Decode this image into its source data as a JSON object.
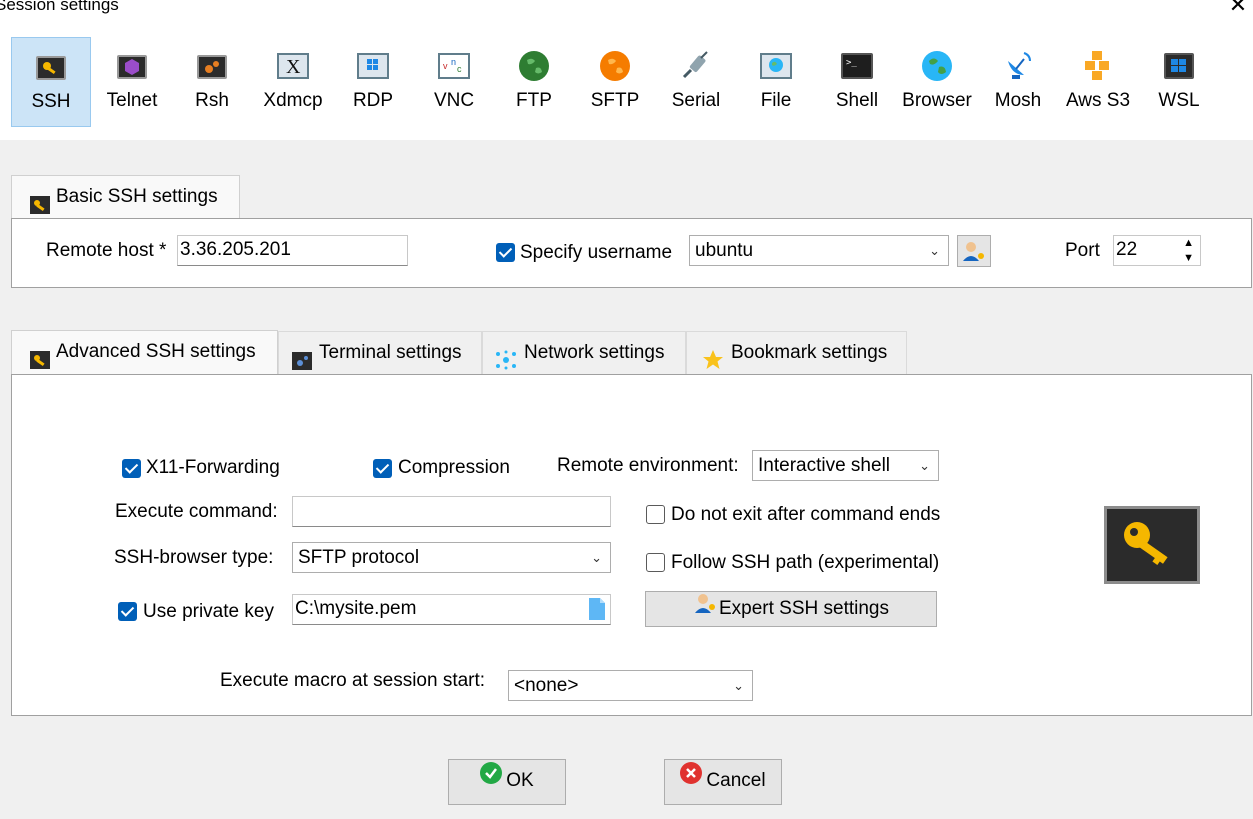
{
  "window": {
    "title": "Session settings",
    "close_glyph": "✕"
  },
  "toolbar": {
    "items": [
      {
        "label": "SSH",
        "icon": "ssh-key-icon"
      },
      {
        "label": "Telnet",
        "icon": "telnet-icon"
      },
      {
        "label": "Rsh",
        "icon": "rsh-icon"
      },
      {
        "label": "Xdmcp",
        "icon": "xdmcp-icon"
      },
      {
        "label": "RDP",
        "icon": "rdp-icon"
      },
      {
        "label": "VNC",
        "icon": "vnc-icon"
      },
      {
        "label": "FTP",
        "icon": "ftp-globe-icon"
      },
      {
        "label": "SFTP",
        "icon": "sftp-globe-icon"
      },
      {
        "label": "Serial",
        "icon": "serial-plug-icon"
      },
      {
        "label": "File",
        "icon": "file-monitor-icon"
      },
      {
        "label": "Shell",
        "icon": "shell-terminal-icon"
      },
      {
        "label": "Browser",
        "icon": "browser-globe-icon"
      },
      {
        "label": "Mosh",
        "icon": "mosh-satellite-icon"
      },
      {
        "label": "Aws S3",
        "icon": "aws-s3-icon"
      },
      {
        "label": "WSL",
        "icon": "wsl-windows-icon"
      }
    ],
    "active": "SSH"
  },
  "basic": {
    "tab_label": "Basic SSH settings",
    "remote_host_label": "Remote host *",
    "remote_host_value": "3.36.205.201",
    "specify_username_label": "Specify username",
    "specify_username_checked": true,
    "username_value": "ubuntu",
    "port_label": "Port",
    "port_value": "22"
  },
  "tabs": [
    {
      "label": "Advanced SSH settings",
      "icon": "wrench-icon",
      "active": true
    },
    {
      "label": "Terminal settings",
      "icon": "terminal-icon",
      "active": false
    },
    {
      "label": "Network settings",
      "icon": "network-icon",
      "active": false
    },
    {
      "label": "Bookmark settings",
      "icon": "star-icon",
      "active": false
    }
  ],
  "advanced": {
    "x11_label": "X11-Forwarding",
    "x11_checked": true,
    "compression_label": "Compression",
    "compression_checked": true,
    "remote_env_label": "Remote environment:",
    "remote_env_value": "Interactive shell",
    "execute_command_label": "Execute command:",
    "execute_command_value": "",
    "do_not_exit_label": "Do not exit after command ends",
    "do_not_exit_checked": false,
    "ssh_browser_label": "SSH-browser type:",
    "ssh_browser_value": "SFTP protocol",
    "follow_path_label": "Follow SSH path (experimental)",
    "follow_path_checked": false,
    "private_key_label": "Use private key",
    "private_key_checked": true,
    "private_key_value": "C:\\mysite.pem",
    "expert_button_label": "Expert SSH settings",
    "macro_label": "Execute macro at session start:",
    "macro_value": "<none>"
  },
  "footer": {
    "ok_label": "OK",
    "cancel_label": "Cancel"
  },
  "colors": {
    "accent": "#005fb8",
    "active_tab_bg": "#cce4f7",
    "ok_green": "#22a845",
    "cancel_red": "#e0322f"
  }
}
